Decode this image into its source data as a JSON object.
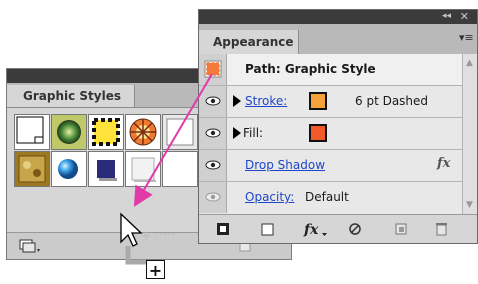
{
  "graphic_styles": {
    "tab_label": "Graphic Styles"
  },
  "appearance": {
    "tab_label": "Appearance",
    "collapse_glyph": "◂◂",
    "close_glyph": "✕",
    "menu_glyph": "▾≡",
    "header": {
      "label": "Path: Graphic Style"
    },
    "rows": [
      {
        "label": "Stroke:",
        "value": "6 pt Dashed",
        "swatch_color": "#f6a23a"
      },
      {
        "label": "Fill:",
        "swatch_color": "#f25a2c"
      },
      {
        "label": "Drop Shadow",
        "fx": "fx"
      },
      {
        "label": "Opacity:",
        "value": "Default"
      }
    ]
  },
  "drag": {
    "plus_glyph": "+"
  },
  "colors": {
    "arrow": "#e23aa8",
    "panel_bg": "#d6d6d6",
    "title_bar": "#3b3b3b",
    "link_blue": "#1f46c9",
    "thumbnail_orange": "#f47a3c"
  }
}
